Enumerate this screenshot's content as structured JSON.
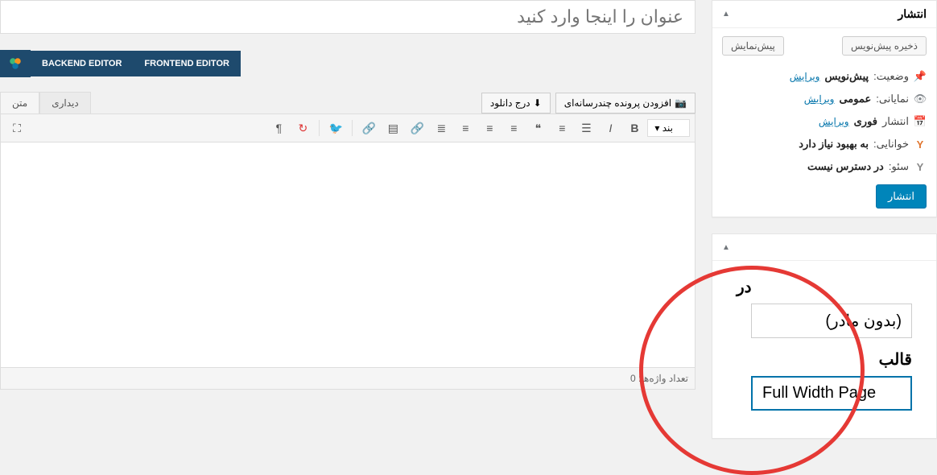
{
  "title_placeholder": "عنوان را اینجا وارد کنید",
  "publish_panel": {
    "title": "انتشار",
    "save_draft": "ذخیره پیش‌نویس",
    "preview": "پیش‌نمایش",
    "status_label": "وضعیت:",
    "status_value": "پیش‌نویس",
    "visibility_label": "نمایانی:",
    "visibility_value": "عمومی",
    "publish_label": "انتشار",
    "publish_value": "فوری",
    "readability_label": "خوانایی:",
    "readability_value": "به بهبود نیاز دارد",
    "seo_label": "سئو:",
    "seo_value": "در دسترس نیست",
    "edit_link": "ویرایش",
    "publish_button": "انتشار"
  },
  "editor_buttons": {
    "frontend": "FRONTEND EDITOR",
    "backend": "BACKEND EDITOR"
  },
  "media": {
    "add_media": "افزودن پرونده چندرسانه‌ای",
    "insert_download": "درج دانلود"
  },
  "tabs": {
    "visual": "دیداری",
    "text": "متن"
  },
  "toolbar": {
    "format": "بند"
  },
  "word_count": {
    "label": "تعداد واژه‌ها:",
    "value": "0"
  },
  "zoom": {
    "parent_truncated": "در",
    "parent_value": "(بدون مادر)",
    "template_label": "قالب",
    "template_value": "Full Width Page"
  }
}
